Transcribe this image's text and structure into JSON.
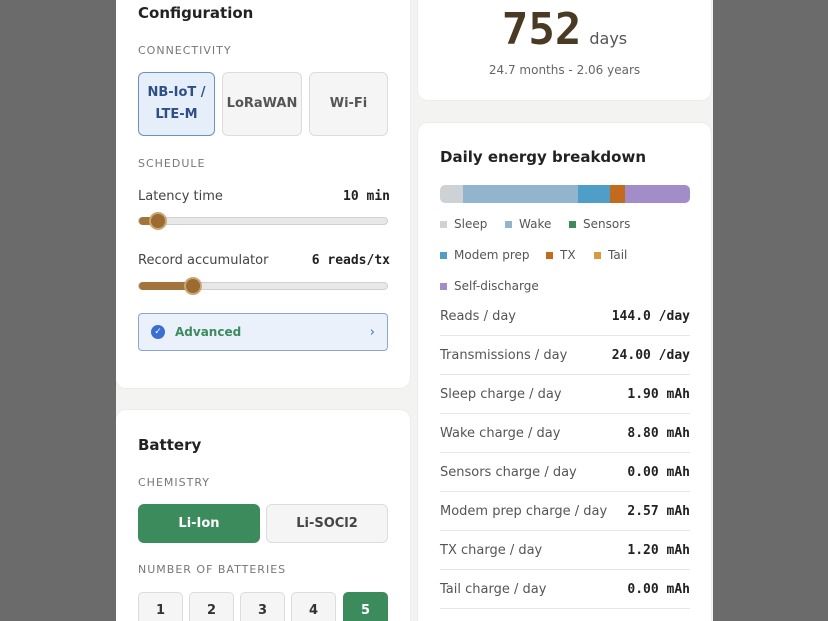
{
  "configuration": {
    "title": "Configuration",
    "connectivity_label": "CONNECTIVITY",
    "connectivity_options": [
      "NB-IoT / LTE-M",
      "LoRaWAN",
      "Wi-Fi"
    ],
    "connectivity_selected": "NB-IoT / LTE-M",
    "schedule_label": "SCHEDULE",
    "latency": {
      "label": "Latency time",
      "value": "10 min",
      "level": 0.05
    },
    "accumulator": {
      "label": "Record accumulator",
      "value": "6 reads/tx",
      "level": 0.19
    },
    "advanced_label": "Advanced"
  },
  "battery": {
    "title": "Battery",
    "chemistry_label": "CHEMISTRY",
    "chemistry_options": [
      "Li-Ion",
      "Li-SOCl2"
    ],
    "chemistry_selected": "Li-Ion",
    "count_label": "NUMBER OF BATTERIES",
    "count_options": [
      "1",
      "2",
      "3",
      "4",
      "5"
    ],
    "count_selected": "5"
  },
  "lifetime": {
    "days": "752",
    "unit": "days",
    "subtitle": "24.7 months - 2.06 years"
  },
  "energy": {
    "title": "Daily energy breakdown",
    "legend": [
      {
        "label": "Sleep",
        "color": "#cfd2d4"
      },
      {
        "label": "Wake",
        "color": "#92b4cc"
      },
      {
        "label": "Sensors",
        "color": "#3c8b5d"
      },
      {
        "label": "Modem prep",
        "color": "#4f9ec8"
      },
      {
        "label": "TX",
        "color": "#c26a1e"
      },
      {
        "label": "Tail",
        "color": "#d89a3e"
      },
      {
        "label": "Self-discharge",
        "color": "#a38dc9"
      }
    ],
    "bar_fractions": {
      "Sleep": 0.09,
      "Wake": 0.46,
      "Sensors": 0.0,
      "Modem prep": 0.13,
      "TX": 0.06,
      "Tail": 0.0,
      "Self-discharge": 0.26
    },
    "rows": [
      {
        "label": "Reads / day",
        "value": "144.0 /day"
      },
      {
        "label": "Transmissions / day",
        "value": "24.00 /day"
      },
      {
        "label": "Sleep charge / day",
        "value": "1.90 mAh"
      },
      {
        "label": "Wake charge / day",
        "value": "8.80 mAh"
      },
      {
        "label": "Sensors charge / day",
        "value": "0.00 mAh"
      },
      {
        "label": "Modem prep charge / day",
        "value": "2.57 mAh"
      },
      {
        "label": "TX charge / day",
        "value": "1.20 mAh"
      },
      {
        "label": "Tail charge / day",
        "value": "0.00 mAh"
      }
    ]
  }
}
